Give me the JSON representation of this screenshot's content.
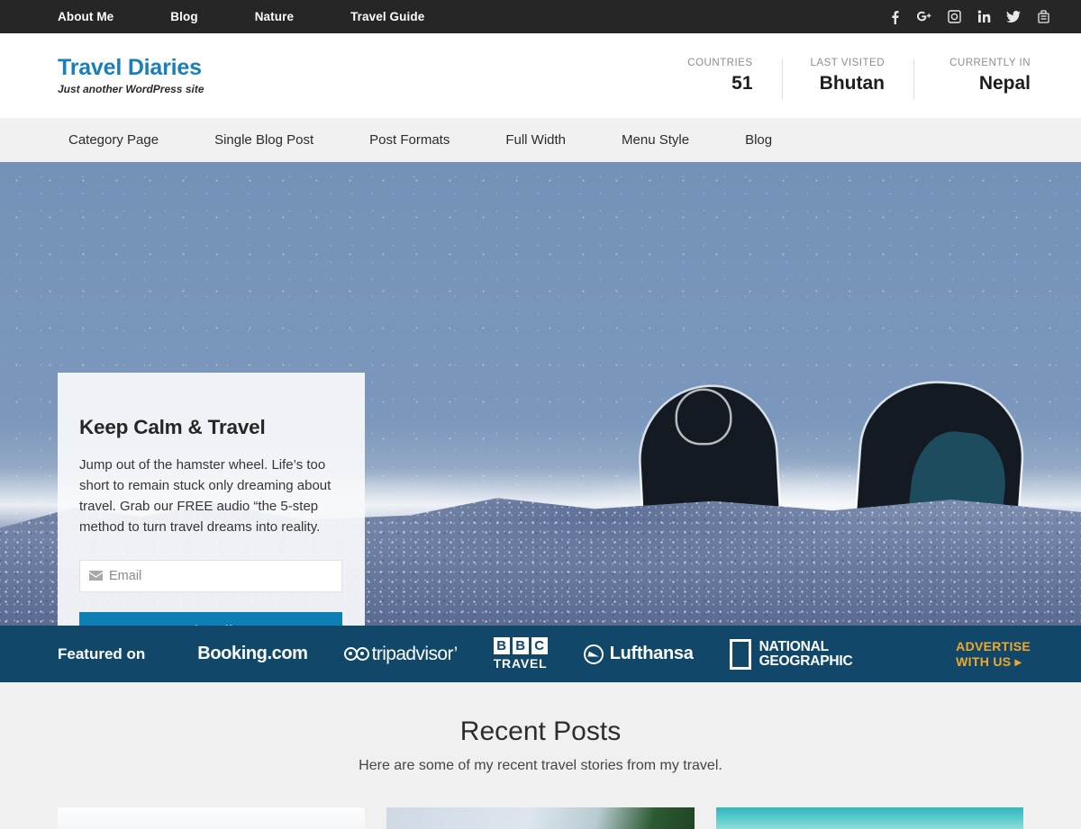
{
  "topbar": {
    "links": [
      {
        "label": "About Me"
      },
      {
        "label": "Blog"
      },
      {
        "label": "Nature"
      },
      {
        "label": "Travel Guide"
      }
    ],
    "social": [
      {
        "name": "facebook-icon"
      },
      {
        "name": "google-plus-icon"
      },
      {
        "name": "instagram-icon"
      },
      {
        "name": "linkedin-icon"
      },
      {
        "name": "twitter-icon"
      },
      {
        "name": "youtube-icon"
      }
    ],
    "background": "#262626"
  },
  "header": {
    "logo_title": "Travel Diaries",
    "logo_tagline": "Just another WordPress site",
    "logo_color": "#1a7fb8",
    "stats": [
      {
        "label": "COUNTRIES",
        "value": "51"
      },
      {
        "label": "LAST VISITED",
        "value": "Bhutan"
      },
      {
        "label": "CURRENTLY IN",
        "value": "Nepal"
      }
    ]
  },
  "mainnav": {
    "items": [
      {
        "label": "Category Page"
      },
      {
        "label": "Single Blog Post"
      },
      {
        "label": "Post Formats"
      },
      {
        "label": "Full Width"
      },
      {
        "label": "Menu Style"
      },
      {
        "label": "Blog"
      }
    ]
  },
  "hero": {
    "subscribe": {
      "title": "Keep Calm & Travel",
      "text": "Jump out of the hamster wheel. Life’s too short to remain stuck only dreaming about travel. Grab our FREE audio “the 5-step method to turn travel dreams into reality.",
      "email_placeholder": "Email",
      "email_value": "",
      "button_label": "Subscribe",
      "button_color": "#0d7fb5"
    }
  },
  "featured": {
    "label": "Featured on",
    "background": "#11486a",
    "brands": [
      {
        "name": "booking-com",
        "text": "Booking.com"
      },
      {
        "name": "tripadvisor",
        "text": "tripadvisor’"
      },
      {
        "name": "bbc-travel",
        "letters": [
          "B",
          "B",
          "C"
        ],
        "text": "TRAVEL"
      },
      {
        "name": "lufthansa",
        "text": "Lufthansa"
      },
      {
        "name": "national-geographic",
        "line1": "NATIONAL",
        "line2": "GEOGRAPHIC"
      }
    ],
    "advertise_line1": "ADVERTISE",
    "advertise_line2": "WITH US ▸",
    "advertise_color": "#f2a92b"
  },
  "recent": {
    "title": "Recent Posts",
    "subtitle": "Here are some of my recent travel stories from my travel.",
    "cards": [
      {
        "name": "post-card-1"
      },
      {
        "name": "post-card-2"
      },
      {
        "name": "post-card-3"
      }
    ]
  }
}
